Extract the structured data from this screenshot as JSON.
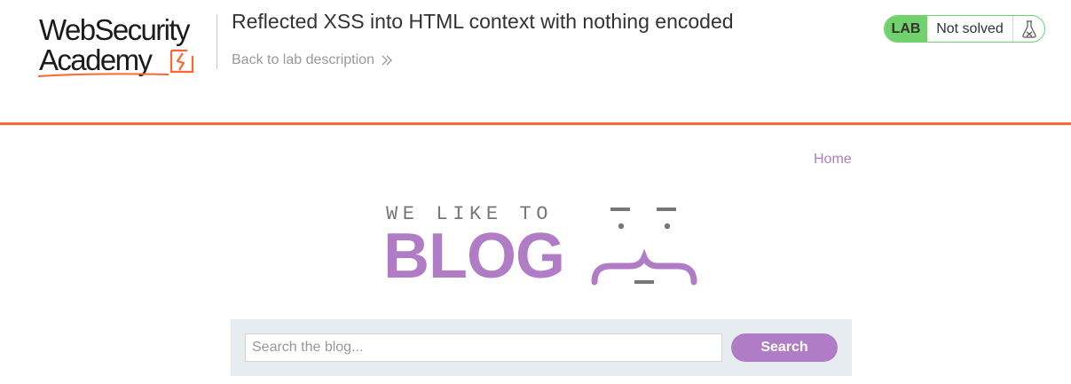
{
  "academy": {
    "logo_line1": "WebSecurity",
    "logo_line2": "Academy",
    "logo_icon": "lightning-badge-icon",
    "lab_title": "Reflected XSS into HTML context with nothing encoded",
    "back_link": "Back to lab description",
    "back_icon": "double-chevron-right-icon",
    "status": {
      "tag": "LAB",
      "state": "Not solved",
      "icon": "flask-icon"
    },
    "colors": {
      "accent": "#ff6633",
      "status_green": "#70d16d",
      "title_text": "#333332",
      "muted_text": "#999999"
    }
  },
  "blog": {
    "nav": {
      "home": "Home"
    },
    "banner": {
      "small_text": "WE LIKE TO",
      "big_text": "BLOG"
    },
    "search": {
      "placeholder": "Search the blog...",
      "value": "",
      "button_label": "Search"
    },
    "colors": {
      "brand_purple": "#b07cc6",
      "search_panel_bg": "#e6ecf0"
    }
  }
}
